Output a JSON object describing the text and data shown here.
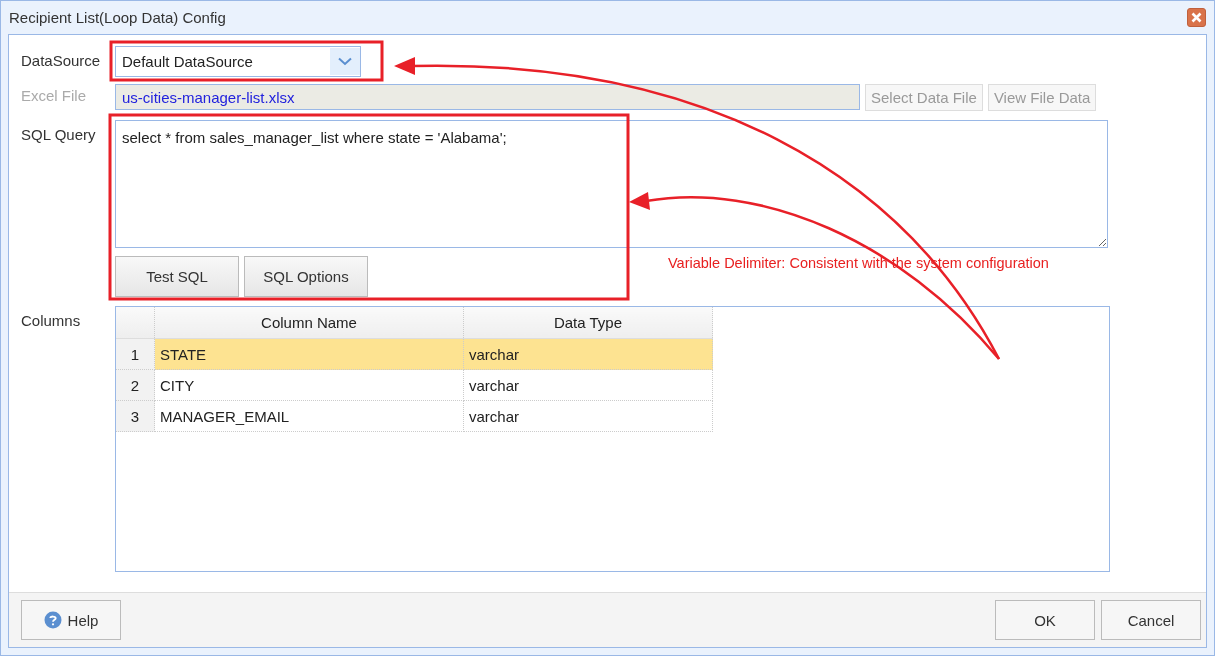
{
  "window": {
    "title": "Recipient List(Loop Data) Config"
  },
  "form": {
    "datasource": {
      "label": "DataSource",
      "value": "Default DataSource"
    },
    "excel_file": {
      "label": "Excel File",
      "value": "us-cities-manager-list.xlsx",
      "disabled": true,
      "buttons": [
        {
          "label": "Select Data File",
          "disabled": true
        },
        {
          "label": "View File Data",
          "disabled": true
        }
      ]
    },
    "sql_query": {
      "label": "SQL Query",
      "value": "select * from sales_manager_list where state = 'Alabama';",
      "buttons": [
        {
          "label": "Test SQL"
        },
        {
          "label": "SQL Options"
        }
      ]
    },
    "columns": {
      "label": "Columns",
      "table": {
        "columns": [
          "Column Name",
          "Data Type"
        ],
        "rows": [
          {
            "index": "1",
            "cells": [
              "STATE",
              "varchar"
            ],
            "selected": true
          },
          {
            "index": "2",
            "cells": [
              "CITY",
              "varchar"
            ],
            "selected": false
          },
          {
            "index": "3",
            "cells": [
              "MANAGER_EMAIL",
              "varchar"
            ],
            "selected": false
          }
        ]
      }
    }
  },
  "annotation": {
    "text": "Variable Delimiter: Consistent with the system configuration"
  },
  "footer": {
    "help": "Help",
    "buttons": [
      "OK",
      "Cancel"
    ]
  }
}
